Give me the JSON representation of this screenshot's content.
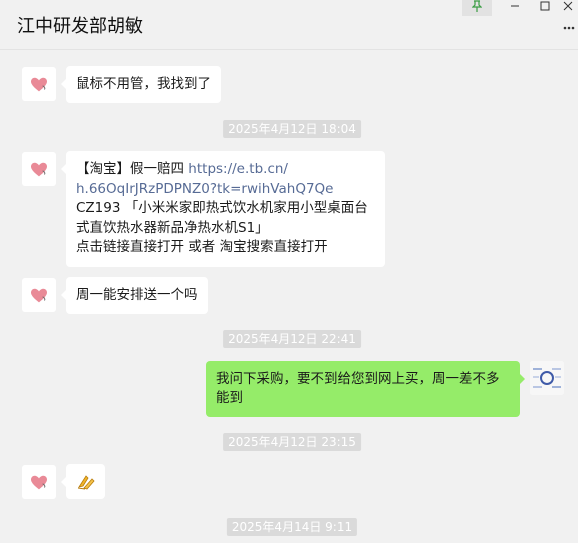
{
  "window": {
    "title": "江中研发部胡敏",
    "controls": {
      "pin": "pin-icon",
      "minimize": "minimize-icon",
      "maximize": "maximize-icon",
      "close": "close-icon",
      "more": "more-icon"
    }
  },
  "colors": {
    "background": "#f1f1f1",
    "bubble_in": "#ffffff",
    "bubble_out": "#95ec69",
    "timestamp_bg": "#dadada",
    "link": "#576b95"
  },
  "messages": [
    {
      "side": "in",
      "text": "鼠标不用管，我找到了"
    },
    {
      "timestamp": "2025年4月12日 18:04"
    },
    {
      "side": "in",
      "line1_prefix": "【淘宝】假一赔四 ",
      "link": "https://e.tb.cn/h.66OqIrJRzPDPNZ0?tk=rwihVahQ7Qe",
      "link_part1": "https://e.tb.cn/",
      "link_part2": "h.66OqIrJRzPDPNZ0?tk=rwihVahQ7Qe",
      "line3": "CZ193 「小米米家即热式饮水机家用小型桌面台",
      "line4": "式直饮热水器新品净热水机S1」",
      "line5": "点击链接直接打开 或者 淘宝搜索直接打开"
    },
    {
      "side": "in",
      "text": "周一能安排送一个吗"
    },
    {
      "timestamp": "2025年4月12日 22:41"
    },
    {
      "side": "out",
      "line1": "我问下采购，要不到给您到网上买，周一差不多",
      "line2": "能到"
    },
    {
      "timestamp": "2025年4月12日 23:15"
    },
    {
      "side": "in",
      "text": "🙏"
    },
    {
      "timestamp": "2025年4月14日 9:11"
    }
  ]
}
